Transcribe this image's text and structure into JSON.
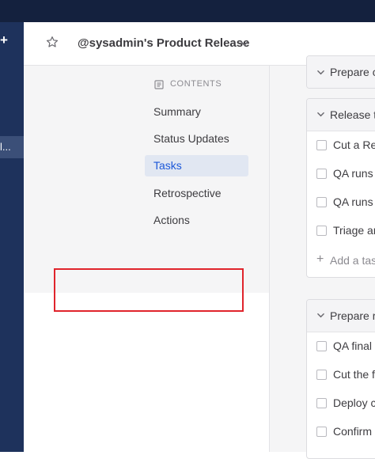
{
  "left_nav": {
    "add_symbol": "+",
    "active_item_label": "l..."
  },
  "header": {
    "title": "@sysadmin's Product Release"
  },
  "contents": {
    "heading": "CONTENTS",
    "items": [
      {
        "label": "Summary",
        "active": false
      },
      {
        "label": "Status Updates",
        "active": false
      },
      {
        "label": "Tasks",
        "active": true
      },
      {
        "label": "Retrospective",
        "active": false
      },
      {
        "label": "Actions",
        "active": false
      }
    ]
  },
  "checklists": [
    {
      "title": "Prepare c",
      "tasks": []
    },
    {
      "title": "Release to",
      "tasks": [
        "Cut a Rel",
        "QA runs s",
        "QA runs a",
        "Triage an"
      ],
      "add_task_label": "Add a tas"
    },
    {
      "title": "Prepare r",
      "tasks": [
        "QA final a",
        "Cut the fi",
        "Deploy cl",
        "Confirm m"
      ]
    }
  ],
  "colors": {
    "topbar": "#14213e",
    "left_nav": "#1e325c",
    "active_toc_bg": "#e1e7f2",
    "active_toc_text": "#1c58d9",
    "highlight_box": "#e0242c"
  }
}
